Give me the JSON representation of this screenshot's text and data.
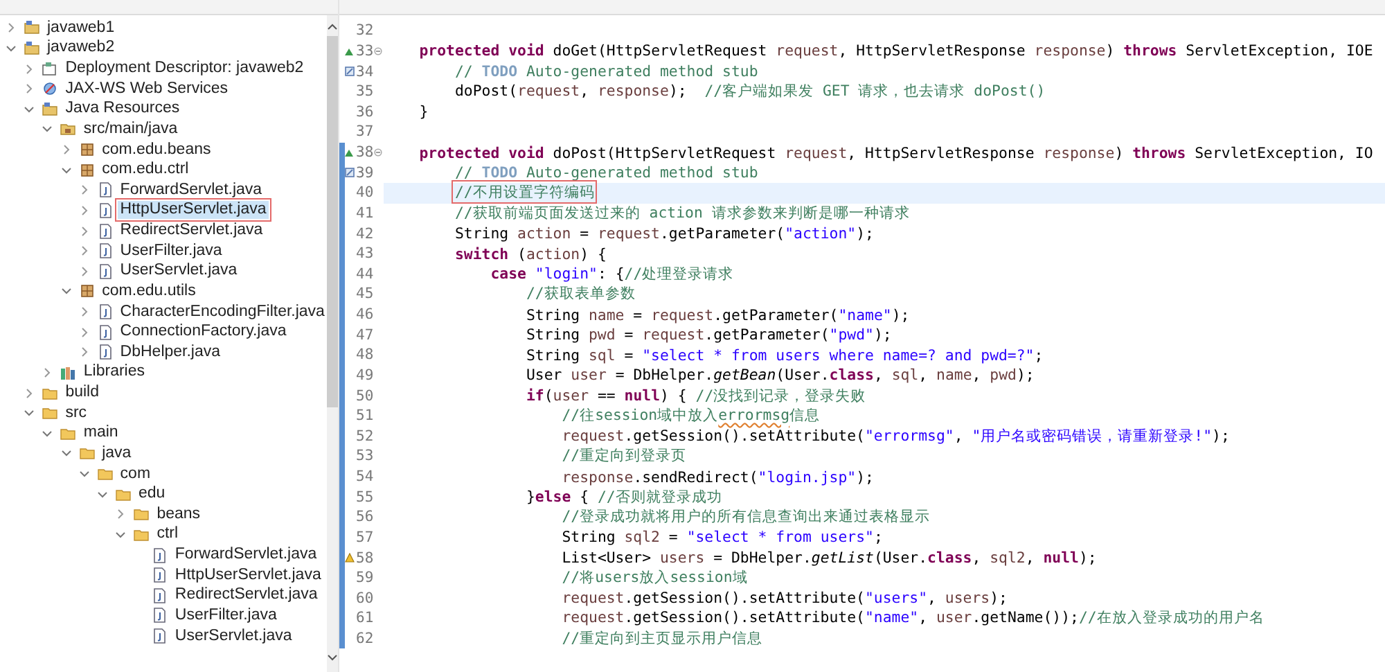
{
  "project_explorer": {
    "tree": [
      {
        "label": "javaweb1",
        "kind": "project",
        "expanded": false,
        "selected": false
      },
      {
        "label": "javaweb2",
        "kind": "project",
        "expanded": true,
        "selected": false,
        "children": [
          {
            "label": "Deployment Descriptor: javaweb2",
            "kind": "descriptor",
            "expanded": false,
            "selected": false
          },
          {
            "label": "JAX-WS Web Services",
            "kind": "webservices",
            "expanded": false,
            "selected": false
          },
          {
            "label": "Java Resources",
            "kind": "resources",
            "expanded": true,
            "selected": false,
            "children": [
              {
                "label": "src/main/java",
                "kind": "source-folder",
                "expanded": true,
                "selected": false,
                "children": [
                  {
                    "label": "com.edu.beans",
                    "kind": "package",
                    "expanded": false,
                    "selected": false
                  },
                  {
                    "label": "com.edu.ctrl",
                    "kind": "package",
                    "expanded": true,
                    "selected": false,
                    "children": [
                      {
                        "label": "ForwardServlet.java",
                        "kind": "java-file",
                        "expanded": false,
                        "selected": false
                      },
                      {
                        "label": "HttpUserServlet.java",
                        "kind": "java-file",
                        "expanded": false,
                        "selected": true
                      },
                      {
                        "label": "RedirectServlet.java",
                        "kind": "java-file",
                        "expanded": false,
                        "selected": false
                      },
                      {
                        "label": "UserFilter.java",
                        "kind": "java-file",
                        "expanded": false,
                        "selected": false
                      },
                      {
                        "label": "UserServlet.java",
                        "kind": "java-file",
                        "expanded": false,
                        "selected": false
                      }
                    ]
                  },
                  {
                    "label": "com.edu.utils",
                    "kind": "package",
                    "expanded": true,
                    "selected": false,
                    "children": [
                      {
                        "label": "CharacterEncodingFilter.java",
                        "kind": "java-file",
                        "expanded": false,
                        "selected": false
                      },
                      {
                        "label": "ConnectionFactory.java",
                        "kind": "java-file",
                        "expanded": false,
                        "selected": false
                      },
                      {
                        "label": "DbHelper.java",
                        "kind": "java-file",
                        "expanded": false,
                        "selected": false
                      }
                    ]
                  }
                ]
              },
              {
                "label": "Libraries",
                "kind": "library",
                "expanded": false,
                "selected": false
              }
            ]
          },
          {
            "label": "build",
            "kind": "folder",
            "expanded": false,
            "selected": false
          },
          {
            "label": "src",
            "kind": "folder",
            "expanded": true,
            "selected": false,
            "children": [
              {
                "label": "main",
                "kind": "folder",
                "expanded": true,
                "selected": false,
                "children": [
                  {
                    "label": "java",
                    "kind": "folder",
                    "expanded": true,
                    "selected": false,
                    "children": [
                      {
                        "label": "com",
                        "kind": "folder",
                        "expanded": true,
                        "selected": false,
                        "children": [
                          {
                            "label": "edu",
                            "kind": "folder",
                            "expanded": true,
                            "selected": false,
                            "children": [
                              {
                                "label": "beans",
                                "kind": "folder",
                                "expanded": false,
                                "selected": false
                              },
                              {
                                "label": "ctrl",
                                "kind": "folder",
                                "expanded": true,
                                "selected": false,
                                "children": [
                                  {
                                    "label": "ForwardServlet.java",
                                    "kind": "file",
                                    "selected": false
                                  },
                                  {
                                    "label": "HttpUserServlet.java",
                                    "kind": "file",
                                    "selected": false
                                  },
                                  {
                                    "label": "RedirectServlet.java",
                                    "kind": "file",
                                    "selected": false
                                  },
                                  {
                                    "label": "UserFilter.java",
                                    "kind": "file",
                                    "selected": false
                                  },
                                  {
                                    "label": "UserServlet.java",
                                    "kind": "file",
                                    "selected": false
                                  }
                                ]
                              }
                            ]
                          }
                        ]
                      }
                    ]
                  }
                ]
              }
            ]
          }
        ]
      }
    ]
  },
  "editor": {
    "lines": [
      {
        "number": "32",
        "kind": "plain",
        "changed": false,
        "current": false
      },
      {
        "number": "33",
        "kind": "override",
        "changed": false,
        "current": false,
        "tokens": [
          {
            "kind": "kw",
            "text": "\tprotected"
          },
          {
            "kind": "kw",
            "text": " void"
          },
          {
            "kind": "plain",
            "text": " doGet(HttpServletRequest "
          },
          {
            "kind": "var",
            "text": "request"
          },
          {
            "kind": "plain",
            "text": ", HttpServletResponse "
          },
          {
            "kind": "var",
            "text": "response"
          },
          {
            "kind": "plain",
            "text": ") "
          },
          {
            "kind": "kw",
            "text": "throws"
          },
          {
            "kind": "plain",
            "text": " ServletException, IOE"
          }
        ]
      },
      {
        "number": "34",
        "kind": "task",
        "changed": false,
        "current": false,
        "tokens": [
          {
            "kind": "comment",
            "text": "\t\t// "
          },
          {
            "kind": "todo",
            "text": "TODO"
          },
          {
            "kind": "comment",
            "text": " Auto-generated method stub"
          }
        ]
      },
      {
        "number": "35",
        "kind": "plain",
        "changed": false,
        "current": false,
        "tokens": [
          {
            "kind": "plain",
            "text": "\t\tdoPost("
          },
          {
            "kind": "var",
            "text": "request"
          },
          {
            "kind": "plain",
            "text": ", "
          },
          {
            "kind": "var",
            "text": "response"
          },
          {
            "kind": "plain",
            "text": ");  "
          },
          {
            "kind": "comment",
            "text": "//客户端如果发 GET 请求，也去请求 doPost()"
          }
        ]
      },
      {
        "number": "36",
        "kind": "plain",
        "changed": false,
        "current": false,
        "tokens": [
          {
            "kind": "plain",
            "text": "\t}"
          }
        ]
      },
      {
        "number": "37",
        "kind": "plain",
        "changed": false,
        "current": false
      },
      {
        "number": "38",
        "kind": "override",
        "changed": true,
        "current": false,
        "tokens": [
          {
            "kind": "kw",
            "text": "\tprotected"
          },
          {
            "kind": "kw",
            "text": " void"
          },
          {
            "kind": "plain",
            "text": " doPost(HttpServletRequest "
          },
          {
            "kind": "var",
            "text": "request"
          },
          {
            "kind": "plain",
            "text": ", HttpServletResponse "
          },
          {
            "kind": "var",
            "text": "response"
          },
          {
            "kind": "plain",
            "text": ") "
          },
          {
            "kind": "kw",
            "text": "throws"
          },
          {
            "kind": "plain",
            "text": " ServletException, IO"
          }
        ]
      },
      {
        "number": "39",
        "kind": "task",
        "changed": true,
        "current": false,
        "tokens": [
          {
            "kind": "comment",
            "text": "\t\t// "
          },
          {
            "kind": "todo",
            "text": "TODO"
          },
          {
            "kind": "comment",
            "text": " Auto-generated method stub"
          }
        ]
      },
      {
        "number": "40",
        "kind": "plain",
        "changed": true,
        "current": true,
        "tokens": [
          {
            "kind": "boxed-comment",
            "text": "//不用设置字符编码"
          }
        ]
      },
      {
        "number": "41",
        "kind": "plain",
        "changed": true,
        "current": false,
        "tokens": [
          {
            "kind": "comment",
            "text": "\t\t//获取前端页面发送过来的 action 请求参数来判断是哪一种请求"
          }
        ]
      },
      {
        "number": "42",
        "kind": "plain",
        "changed": true,
        "current": false,
        "tokens": [
          {
            "kind": "plain",
            "text": "\t\tString "
          },
          {
            "kind": "var",
            "text": "action"
          },
          {
            "kind": "plain",
            "text": " = "
          },
          {
            "kind": "var",
            "text": "request"
          },
          {
            "kind": "plain",
            "text": ".getParameter("
          },
          {
            "kind": "str",
            "text": "\"action\""
          },
          {
            "kind": "plain",
            "text": ");"
          }
        ]
      },
      {
        "number": "43",
        "kind": "plain",
        "changed": true,
        "current": false,
        "tokens": [
          {
            "kind": "kw",
            "text": "\t\tswitch"
          },
          {
            "kind": "plain",
            "text": " ("
          },
          {
            "kind": "var",
            "text": "action"
          },
          {
            "kind": "plain",
            "text": ") {"
          }
        ]
      },
      {
        "number": "44",
        "kind": "plain",
        "changed": true,
        "current": false,
        "tokens": [
          {
            "kind": "kw",
            "text": "\t\t\tcase"
          },
          {
            "kind": "str",
            "text": " \"login\""
          },
          {
            "kind": "plain",
            "text": ": {"
          },
          {
            "kind": "comment",
            "text": "//处理登录请求"
          }
        ]
      },
      {
        "number": "45",
        "kind": "plain",
        "changed": true,
        "current": false,
        "tokens": [
          {
            "kind": "comment",
            "text": "\t\t\t\t//获取表单参数"
          }
        ]
      },
      {
        "number": "46",
        "kind": "plain",
        "changed": true,
        "current": false,
        "tokens": [
          {
            "kind": "plain",
            "text": "\t\t\t\tString "
          },
          {
            "kind": "var",
            "text": "name"
          },
          {
            "kind": "plain",
            "text": " = "
          },
          {
            "kind": "var",
            "text": "request"
          },
          {
            "kind": "plain",
            "text": ".getParameter("
          },
          {
            "kind": "str",
            "text": "\"name\""
          },
          {
            "kind": "plain",
            "text": ");"
          }
        ]
      },
      {
        "number": "47",
        "kind": "plain",
        "changed": true,
        "current": false,
        "tokens": [
          {
            "kind": "plain",
            "text": "\t\t\t\tString "
          },
          {
            "kind": "var",
            "text": "pwd"
          },
          {
            "kind": "plain",
            "text": " = "
          },
          {
            "kind": "var",
            "text": "request"
          },
          {
            "kind": "plain",
            "text": ".getParameter("
          },
          {
            "kind": "str",
            "text": "\"pwd\""
          },
          {
            "kind": "plain",
            "text": ");"
          }
        ]
      },
      {
        "number": "48",
        "kind": "plain",
        "changed": true,
        "current": false,
        "tokens": [
          {
            "kind": "plain",
            "text": "\t\t\t\tString "
          },
          {
            "kind": "var",
            "text": "sql"
          },
          {
            "kind": "plain",
            "text": " = "
          },
          {
            "kind": "str",
            "text": "\"select * from users where name=? and pwd=?\""
          },
          {
            "kind": "plain",
            "text": ";"
          }
        ]
      },
      {
        "number": "49",
        "kind": "plain",
        "changed": true,
        "current": false,
        "tokens": [
          {
            "kind": "plain",
            "text": "\t\t\t\tUser "
          },
          {
            "kind": "var",
            "text": "user"
          },
          {
            "kind": "plain",
            "text": " = DbHelper."
          },
          {
            "kind": "static",
            "text": "getBean"
          },
          {
            "kind": "plain",
            "text": "(User."
          },
          {
            "kind": "kw",
            "text": "class"
          },
          {
            "kind": "plain",
            "text": ", "
          },
          {
            "kind": "var",
            "text": "sql"
          },
          {
            "kind": "plain",
            "text": ", "
          },
          {
            "kind": "var",
            "text": "name"
          },
          {
            "kind": "plain",
            "text": ", "
          },
          {
            "kind": "var",
            "text": "pwd"
          },
          {
            "kind": "plain",
            "text": ");"
          }
        ]
      },
      {
        "number": "50",
        "kind": "plain",
        "changed": true,
        "current": false,
        "tokens": [
          {
            "kind": "kw",
            "text": "\t\t\t\tif"
          },
          {
            "kind": "plain",
            "text": "("
          },
          {
            "kind": "var",
            "text": "user"
          },
          {
            "kind": "plain",
            "text": " == "
          },
          {
            "kind": "kw",
            "text": "null"
          },
          {
            "kind": "plain",
            "text": ") { "
          },
          {
            "kind": "comment",
            "text": "//没找到记录，登录失败"
          }
        ]
      },
      {
        "number": "51",
        "kind": "plain",
        "changed": true,
        "current": false,
        "tokens": [
          {
            "kind": "comment",
            "text": "\t\t\t\t\t//往session域中放入"
          },
          {
            "kind": "misspelled-comment",
            "text": "errormsg"
          },
          {
            "kind": "comment",
            "text": "信息"
          }
        ]
      },
      {
        "number": "52",
        "kind": "plain",
        "changed": true,
        "current": false,
        "tokens": [
          {
            "kind": "var",
            "text": "\t\t\t\t\trequest"
          },
          {
            "kind": "plain",
            "text": ".getSession().setAttribute("
          },
          {
            "kind": "str",
            "text": "\"errormsg\""
          },
          {
            "kind": "plain",
            "text": ", "
          },
          {
            "kind": "str",
            "text": "\"用户名或密码错误，请重新登录!\""
          },
          {
            "kind": "plain",
            "text": ");"
          }
        ]
      },
      {
        "number": "53",
        "kind": "plain",
        "changed": true,
        "current": false,
        "tokens": [
          {
            "kind": "comment",
            "text": "\t\t\t\t\t//重定向到登录页"
          }
        ]
      },
      {
        "number": "54",
        "kind": "plain",
        "changed": true,
        "current": false,
        "tokens": [
          {
            "kind": "var",
            "text": "\t\t\t\t\tresponse"
          },
          {
            "kind": "plain",
            "text": ".sendRedirect("
          },
          {
            "kind": "str",
            "text": "\"login.jsp\""
          },
          {
            "kind": "plain",
            "text": ");"
          }
        ]
      },
      {
        "number": "55",
        "kind": "plain",
        "changed": true,
        "current": false,
        "tokens": [
          {
            "kind": "plain",
            "text": "\t\t\t\t}"
          },
          {
            "kind": "kw",
            "text": "else"
          },
          {
            "kind": "plain",
            "text": " { "
          },
          {
            "kind": "comment",
            "text": "//否则就登录成功"
          }
        ]
      },
      {
        "number": "56",
        "kind": "plain",
        "changed": true,
        "current": false,
        "tokens": [
          {
            "kind": "comment",
            "text": "\t\t\t\t\t//登录成功就将用户的所有信息查询出来通过表格显示"
          }
        ]
      },
      {
        "number": "57",
        "kind": "plain",
        "changed": true,
        "current": false,
        "tokens": [
          {
            "kind": "plain",
            "text": "\t\t\t\t\tString "
          },
          {
            "kind": "var",
            "text": "sql2"
          },
          {
            "kind": "plain",
            "text": " = "
          },
          {
            "kind": "str",
            "text": "\"select * from users\""
          },
          {
            "kind": "plain",
            "text": ";"
          }
        ]
      },
      {
        "number": "58",
        "kind": "warning",
        "changed": true,
        "current": false,
        "tokens": [
          {
            "kind": "plain",
            "text": "\t\t\t\t\tList<User> "
          },
          {
            "kind": "var",
            "text": "users"
          },
          {
            "kind": "plain",
            "text": " = DbHelper."
          },
          {
            "kind": "static",
            "text": "getList"
          },
          {
            "kind": "plain",
            "text": "(User."
          },
          {
            "kind": "kw",
            "text": "class"
          },
          {
            "kind": "plain",
            "text": ", "
          },
          {
            "kind": "var",
            "text": "sql2"
          },
          {
            "kind": "plain",
            "text": ", "
          },
          {
            "kind": "kw",
            "text": "null"
          },
          {
            "kind": "plain",
            "text": ");"
          }
        ]
      },
      {
        "number": "59",
        "kind": "plain",
        "changed": true,
        "current": false,
        "tokens": [
          {
            "kind": "comment",
            "text": "\t\t\t\t\t//将users放入session域"
          }
        ]
      },
      {
        "number": "60",
        "kind": "plain",
        "changed": true,
        "current": false,
        "tokens": [
          {
            "kind": "var",
            "text": "\t\t\t\t\trequest"
          },
          {
            "kind": "plain",
            "text": ".getSession().setAttribute("
          },
          {
            "kind": "str",
            "text": "\"users\""
          },
          {
            "kind": "plain",
            "text": ", "
          },
          {
            "kind": "var",
            "text": "users"
          },
          {
            "kind": "plain",
            "text": ");"
          }
        ]
      },
      {
        "number": "61",
        "kind": "plain",
        "changed": true,
        "current": false,
        "tokens": [
          {
            "kind": "var",
            "text": "\t\t\t\t\trequest"
          },
          {
            "kind": "plain",
            "text": ".getSession().setAttribute("
          },
          {
            "kind": "str",
            "text": "\"name\""
          },
          {
            "kind": "plain",
            "text": ", "
          },
          {
            "kind": "var",
            "text": "user"
          },
          {
            "kind": "plain",
            "text": ".getName());"
          },
          {
            "kind": "comment",
            "text": "//在放入登录成功的用户名"
          }
        ]
      },
      {
        "number": "62",
        "kind": "plain",
        "changed": true,
        "current": false,
        "tokens": [
          {
            "kind": "comment",
            "text": "\t\t\t\t\t//重定向到主页显示用户信息"
          }
        ]
      }
    ]
  }
}
